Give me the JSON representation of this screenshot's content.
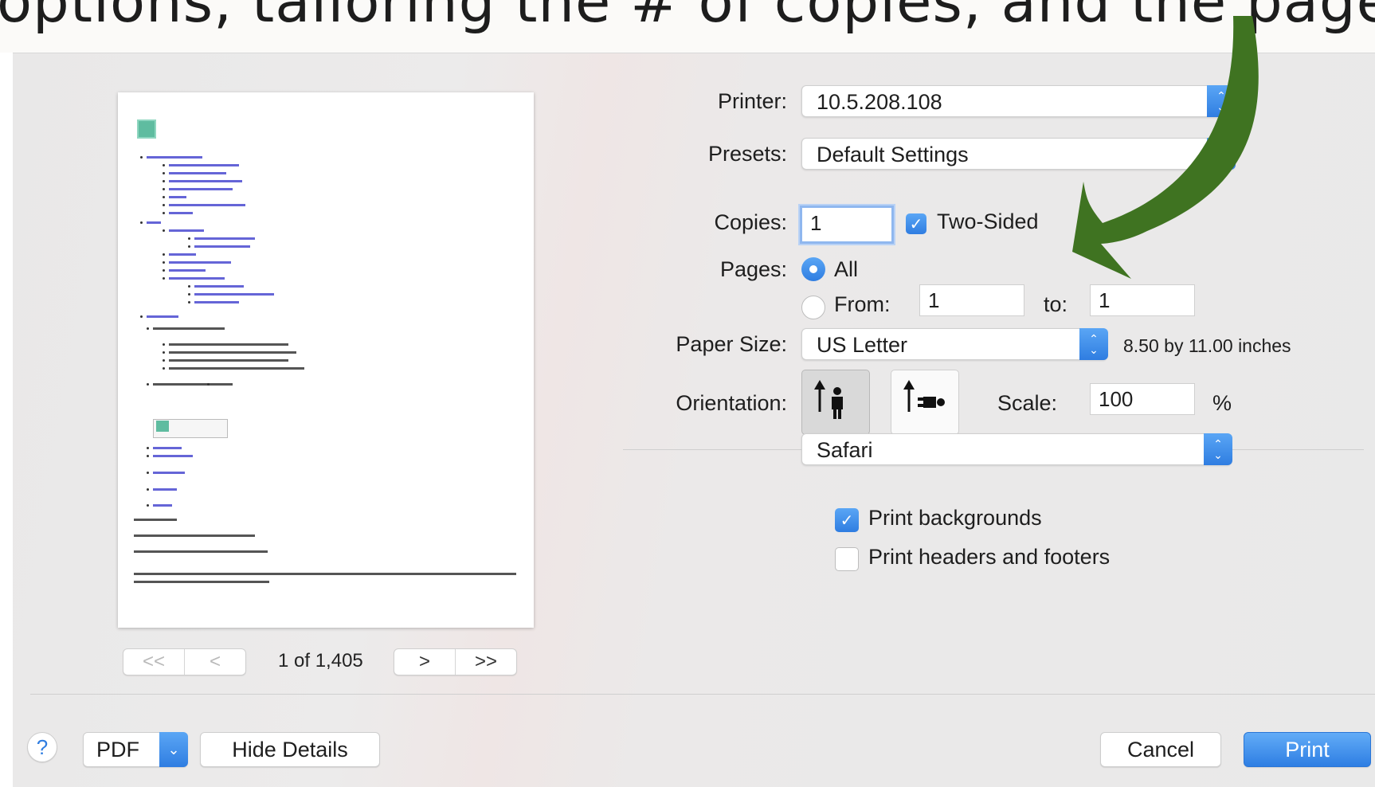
{
  "caption": "options, tailoring the # of copies, and the pages to print, e.g.",
  "preview": {
    "page_counter": "1 of 1,405",
    "nav": {
      "first": "<<",
      "prev": "<",
      "next": ">",
      "last": ">>"
    }
  },
  "printer": {
    "label": "Printer:",
    "value": "10.5.208.108"
  },
  "presets": {
    "label": "Presets:",
    "value": "Default Settings"
  },
  "copies": {
    "label": "Copies:",
    "value": "1",
    "two_sided_label": "Two-Sided",
    "two_sided": true
  },
  "pages": {
    "label": "Pages:",
    "all_label": "All",
    "from_label": "From:",
    "from_value": "1",
    "to_label": "to:",
    "to_value": "1",
    "selected": "All"
  },
  "paper_size": {
    "label": "Paper Size:",
    "value": "US Letter",
    "dimensions": "8.50 by 11.00 inches"
  },
  "orientation": {
    "label": "Orientation:",
    "selected": "portrait"
  },
  "scale": {
    "label": "Scale:",
    "value": "100",
    "unit": "%"
  },
  "app_section": {
    "value": "Safari"
  },
  "options": {
    "print_backgrounds": {
      "label": "Print backgrounds",
      "checked": true
    },
    "headers_footers": {
      "label": "Print headers and footers",
      "checked": false
    }
  },
  "footer": {
    "help": "?",
    "pdf_label": "PDF",
    "hide_details": "Hide Details",
    "cancel": "Cancel",
    "print": "Print"
  },
  "colors": {
    "accent": "#2f7de1",
    "annotation_arrow": "#3f7321"
  }
}
